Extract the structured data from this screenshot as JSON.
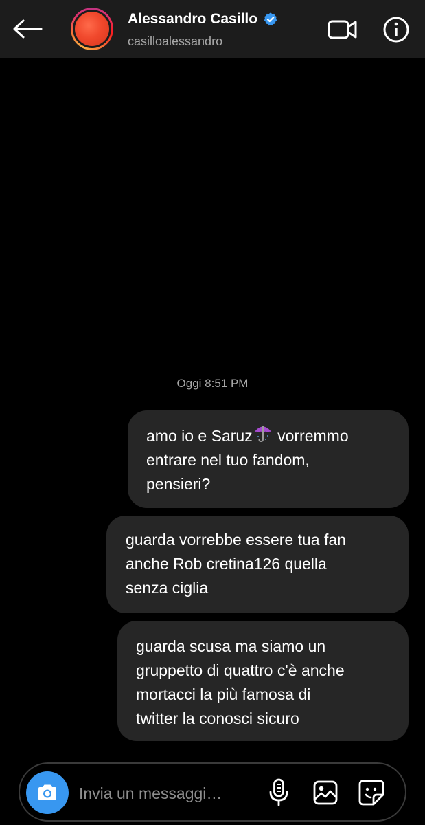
{
  "header": {
    "name": "Alessandro Casillo",
    "username": "casilloalessandro",
    "verified": true
  },
  "conversation": {
    "timestamp": "Oggi 8:51 PM",
    "messages": [
      {
        "before_emoji": "amo io e Saruz",
        "emoji": "umbrella",
        "after_emoji": " vorremmo\nentrare nel tuo fandom,\npensieri?"
      },
      {
        "text": "guarda vorrebbe essere tua fan\nanche Rob cretina126 quella\nsenza ciglia"
      },
      {
        "text": "guarda scusa ma siamo un\ngruppetto di quattro c'è anche\nmortacci la più famosa di\ntwitter la conosci sicuro"
      }
    ]
  },
  "composer": {
    "placeholder": "Invia un messaggi…",
    "value": ""
  },
  "colors": {
    "background": "#000000",
    "header": "#1c1c1c",
    "bubble": "#262626",
    "accent": "#3897f0",
    "verified": "#3897f0",
    "secondary_text": "#a8a8a8"
  },
  "icons": [
    "back-arrow-icon",
    "verified-badge-icon",
    "video-call-icon",
    "info-icon",
    "camera-icon",
    "microphone-icon",
    "gallery-icon",
    "sticker-icon",
    "umbrella-emoji-icon"
  ]
}
